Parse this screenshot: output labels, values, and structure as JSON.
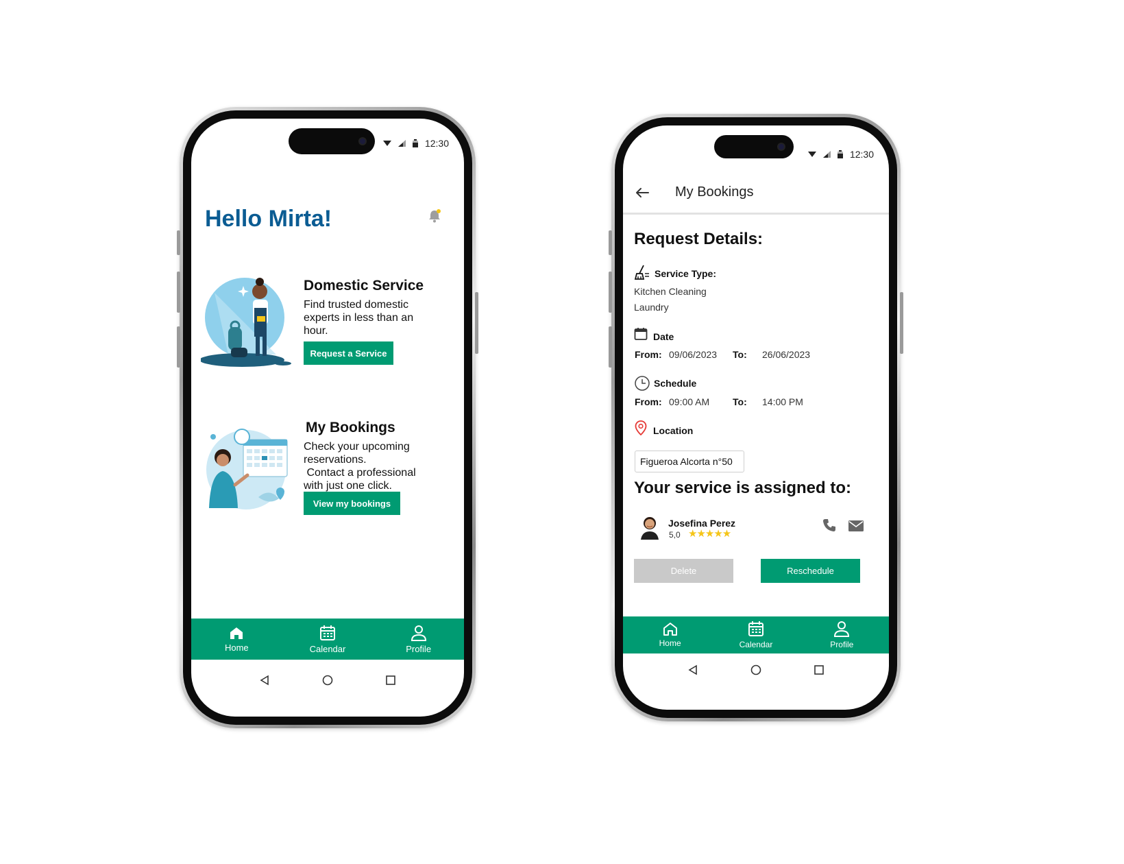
{
  "status": {
    "time": "12:30"
  },
  "home": {
    "greeting": "Hello Mirta!",
    "cards": [
      {
        "title": "Domestic Service",
        "desc": [
          "Find trusted domestic",
          "experts in less than an",
          "hour."
        ],
        "button": "Request a Service"
      },
      {
        "title": "My Bookings",
        "desc": [
          "Check your upcoming",
          "reservations.",
          " Contact a professional",
          "with just one click."
        ],
        "button": "View my bookings"
      }
    ]
  },
  "tabs": [
    "Home",
    "Calendar",
    "Profile"
  ],
  "bookings": {
    "title": "My Bookings",
    "heading": "Request Details:",
    "service_label": "Service Type:",
    "services": [
      "Kitchen Cleaning",
      "Laundry"
    ],
    "date_label": "Date",
    "from_label": "From:",
    "to_label": "To:",
    "date_from": "09/06/2023",
    "date_to": "26/06/2023",
    "schedule_label": "Schedule",
    "time_from": "09:00 AM",
    "time_to": "14:00 PM",
    "location_label": "Location",
    "location": "Figueroa Alcorta n°50",
    "assigned_heading": "Your service is assigned to:",
    "pro_name": "Josefina Perez",
    "rating": "5,0",
    "stars": "★★★★★",
    "delete": "Delete",
    "reschedule": "Reschedule"
  },
  "colors": {
    "accent": "#009b72",
    "title_blue": "#0b5c93",
    "star": "#f5c518",
    "pin": "#e53935"
  }
}
